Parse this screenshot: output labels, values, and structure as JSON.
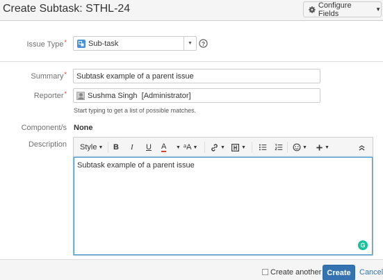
{
  "dialog": {
    "title": "Create Subtask: STHL-24",
    "configure_label": "Configure Fields"
  },
  "form": {
    "issue_type": {
      "label": "Issue Type",
      "value": "Sub-task",
      "required_mark": "*"
    },
    "summary": {
      "label": "Summary",
      "value": "Subtask example of a parent issue",
      "required_mark": "*"
    },
    "reporter": {
      "label": "Reporter",
      "value": "Sushma Singh  [Administrator]",
      "hint": "Start typing to get a list of possible matches.",
      "required_mark": "*"
    },
    "components": {
      "label": "Component/s",
      "value": "None"
    },
    "description": {
      "label": "Description",
      "value": "Subtask example of a parent issue"
    }
  },
  "toolbar": {
    "style_label": "Style",
    "bold": "B",
    "italic": "I",
    "underline": "U",
    "text_color": "A",
    "more_format": "ᵃA"
  },
  "footer": {
    "create_another_label": "Create another",
    "create_label": "Create",
    "cancel_label": "Cancel"
  },
  "colors": {
    "primary": "#3572b0",
    "required": "#d04437",
    "focus": "#4a9ad6",
    "grammarly": "#15c39a"
  }
}
